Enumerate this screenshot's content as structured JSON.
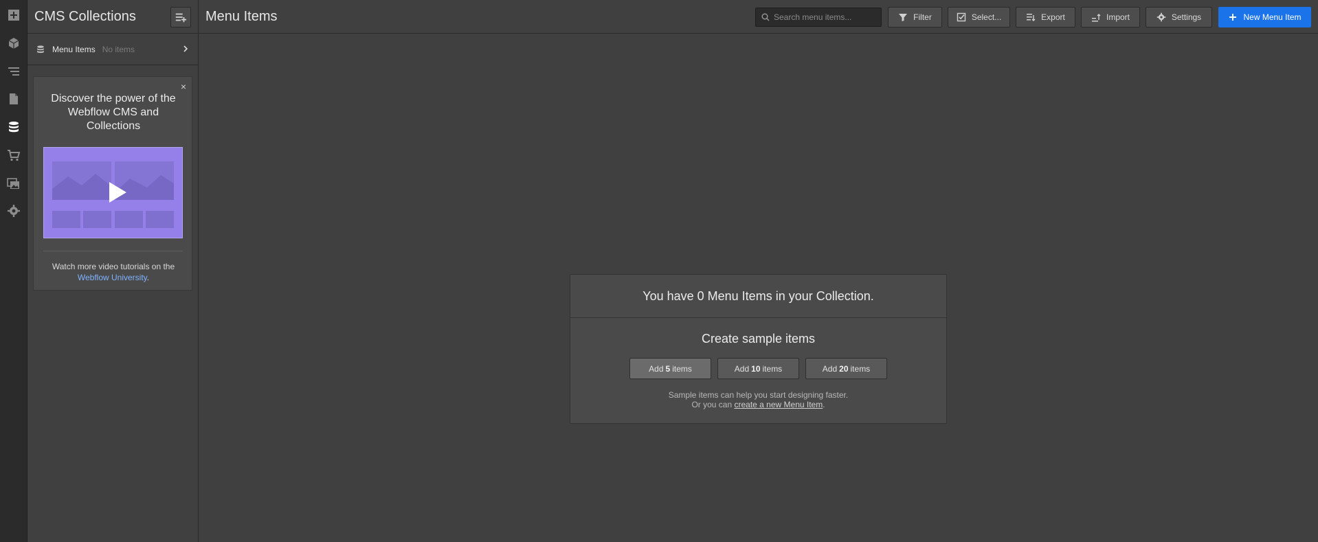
{
  "rail": {
    "items": [
      "add-panel-icon",
      "components-icon",
      "navigator-icon",
      "pages-icon",
      "cms-icon",
      "ecommerce-icon",
      "assets-icon",
      "settings-icon"
    ],
    "active": "cms-icon"
  },
  "panel": {
    "title": "CMS Collections",
    "collections": [
      {
        "name": "Menu Items",
        "count": "No items"
      }
    ],
    "promo": {
      "close": "×",
      "title": "Discover the power of the Webflow CMS and Collections",
      "footer_text": "Watch more video tutorials on the",
      "footer_link": "Webflow University",
      "footer_end": "."
    }
  },
  "toolbar": {
    "title": "Menu Items",
    "search_placeholder": "Search menu items...",
    "filter": "Filter",
    "select": "Select...",
    "export": "Export",
    "import": "Import",
    "settings": "Settings",
    "new_item": "New Menu Item"
  },
  "empty": {
    "message": "You have 0 Menu Items in your Collection.",
    "sample_title": "Create sample items",
    "buttons": [
      {
        "pre": "Add",
        "num": "5",
        "post": "items"
      },
      {
        "pre": "Add",
        "num": "10",
        "post": "items"
      },
      {
        "pre": "Add",
        "num": "20",
        "post": "items"
      }
    ],
    "note_line1": "Sample items can help you start designing faster.",
    "note_line2": "Or you can",
    "note_link": "create a new Menu Item",
    "note_end": "."
  },
  "colors": {
    "primary": "#1a73e8",
    "video_bg": "#9480e8",
    "link": "#7fb3ff"
  }
}
